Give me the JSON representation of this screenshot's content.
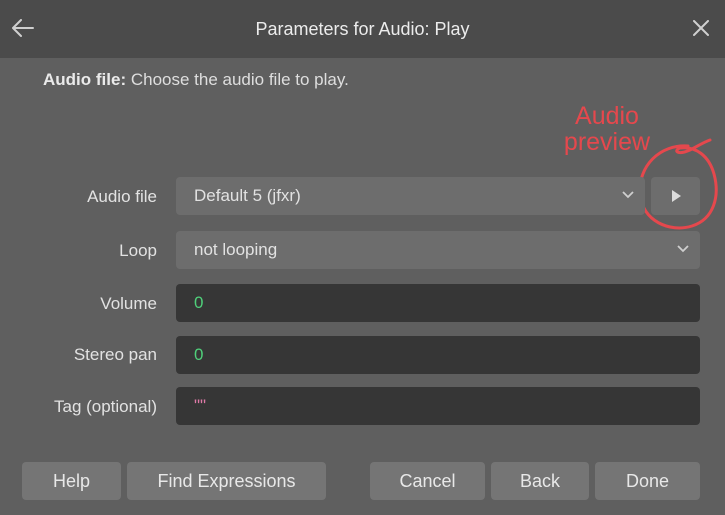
{
  "titlebar": {
    "title": "Parameters for Audio: Play"
  },
  "description": {
    "label": "Audio file:",
    "text": " Choose the audio file to play."
  },
  "annotation": {
    "line1": "Audio",
    "line2": "preview",
    "color": "#e5484d"
  },
  "fields": {
    "audio_file": {
      "label": "Audio file",
      "value": "Default 5 (jfxr)"
    },
    "loop": {
      "label": "Loop",
      "value": "not looping"
    },
    "volume": {
      "label": "Volume",
      "value": "0"
    },
    "stereo_pan": {
      "label": "Stereo pan",
      "value": "0"
    },
    "tag": {
      "label": "Tag (optional)",
      "value": "\"\""
    }
  },
  "buttons": {
    "help": "Help",
    "find_expressions": "Find Expressions",
    "cancel": "Cancel",
    "back": "Back",
    "done": "Done"
  },
  "icons": {
    "back": "arrow-left-icon",
    "close": "close-icon",
    "chevron": "chevron-down-icon",
    "play": "play-icon"
  }
}
